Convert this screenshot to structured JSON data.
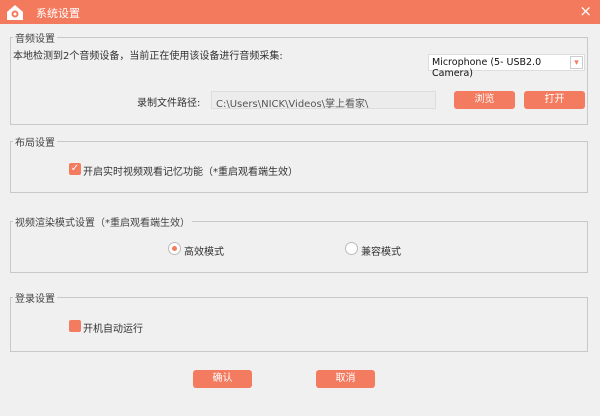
{
  "window": {
    "title": "系统设置",
    "close_icon": "×"
  },
  "audio": {
    "legend": "音频设置",
    "info": "本地检测到2个音频设备，当前正在使用该设备进行音频采集:",
    "device": "Microphone (5- USB2.0 Camera)",
    "path_label": "录制文件路径:",
    "path_value": "C:\\Users\\NICK\\Videos\\掌上看家\\",
    "browse": "浏览",
    "open": "打开"
  },
  "layout": {
    "legend": "布局设置",
    "memory_label": "开启实时视频观看记忆功能（*重启观看端生效）",
    "memory_checked": true
  },
  "render": {
    "legend": "视频渲染模式设置（*重启观看端生效）",
    "efficient": "高效模式",
    "compatible": "兼容模式",
    "selected": "高效模式"
  },
  "login": {
    "legend": "登录设置",
    "autostart_label": "开机自动运行",
    "autostart_checked": false
  },
  "footer": {
    "ok": "确认",
    "cancel": "取消"
  },
  "colors": {
    "accent": "#f37b5f"
  }
}
